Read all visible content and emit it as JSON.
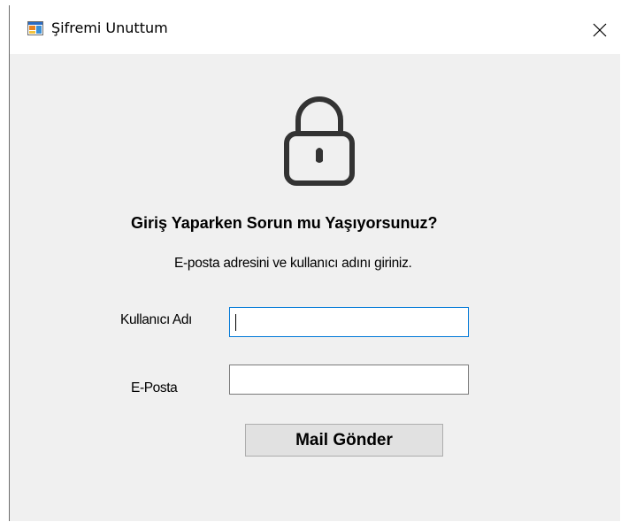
{
  "window": {
    "title": "Şifremi Unuttum",
    "app_icon": "winforms-app-icon",
    "close_icon": "close-icon"
  },
  "form": {
    "lock_icon": "lock-icon",
    "heading": "Giriş Yaparken Sorun mu Yaşıyorsunuz?",
    "instructions": "E-posta adresini ve kullanıcı adını giriniz.",
    "username_label": "Kullanıcı Adı",
    "username_value": "",
    "email_label": "E-Posta",
    "email_value": "",
    "send_button_label": "Mail Gönder"
  },
  "colors": {
    "window_bg": "#f0f0f0",
    "titlebar_bg": "#ffffff",
    "focus_border": "#0078d7",
    "button_bg": "#e1e1e1"
  }
}
